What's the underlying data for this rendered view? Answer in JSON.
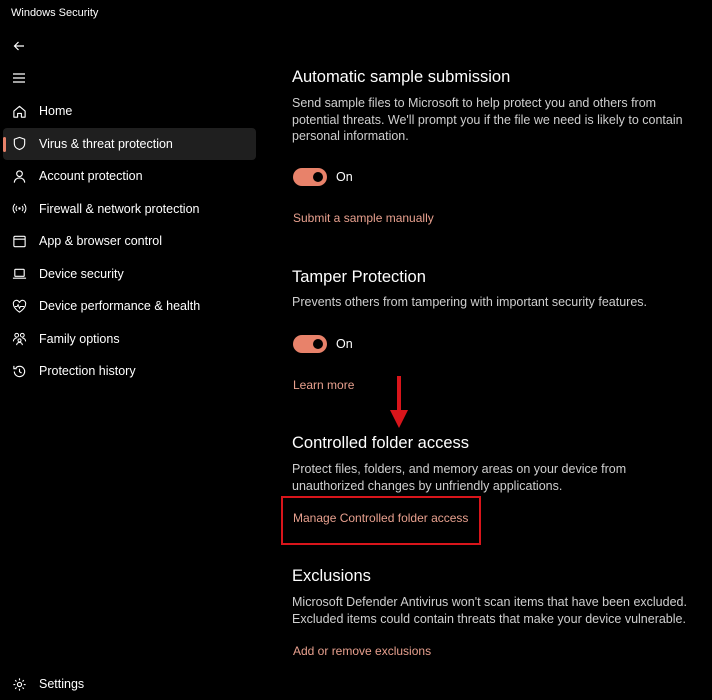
{
  "window": {
    "title": "Windows Security"
  },
  "sidebar": {
    "items": [
      {
        "label": "Home",
        "icon": "home-icon"
      },
      {
        "label": "Virus & threat protection",
        "icon": "shield-icon",
        "active": true
      },
      {
        "label": "Account protection",
        "icon": "person-icon"
      },
      {
        "label": "Firewall & network protection",
        "icon": "wifi-icon"
      },
      {
        "label": "App & browser control",
        "icon": "app-window-icon"
      },
      {
        "label": "Device security",
        "icon": "laptop-icon"
      },
      {
        "label": "Device performance & health",
        "icon": "heart-pulse-icon"
      },
      {
        "label": "Family options",
        "icon": "family-icon"
      },
      {
        "label": "Protection history",
        "icon": "history-icon"
      }
    ],
    "settings_label": "Settings"
  },
  "sections": {
    "auto_sample": {
      "title": "Automatic sample submission",
      "description": "Send sample files to Microsoft to help protect you and others from potential threats. We'll prompt you if the file we need is likely to contain personal information.",
      "toggle_label": "On",
      "link": "Submit a sample manually"
    },
    "tamper": {
      "title": "Tamper Protection",
      "description": "Prevents others from tampering with important security features.",
      "toggle_label": "On",
      "link": "Learn more"
    },
    "controlled_folder": {
      "title": "Controlled folder access",
      "description": "Protect files, folders, and memory areas on your device from unauthorized changes by unfriendly applications.",
      "link": "Manage Controlled folder access"
    },
    "exclusions": {
      "title": "Exclusions",
      "description": "Microsoft Defender Antivirus won't scan items that have been excluded. Excluded items could contain threats that make your device vulnerable.",
      "link": "Add or remove exclusions"
    }
  },
  "colors": {
    "accent": "#e8826a",
    "link": "#e8a08e",
    "annotation": "#d9151b",
    "background": "#000000"
  }
}
